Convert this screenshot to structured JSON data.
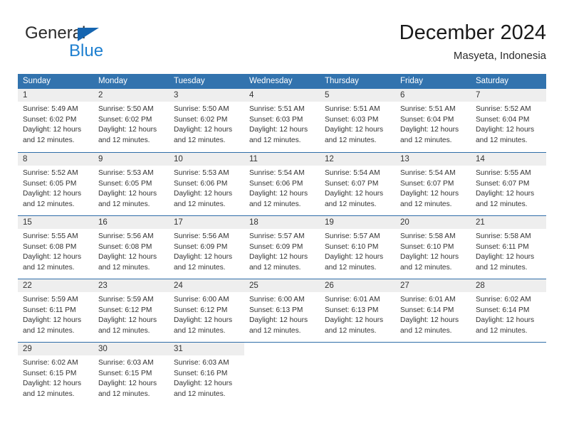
{
  "brand": {
    "word_one": "General",
    "word_two": "Blue",
    "accent_color": "#1d7fd0",
    "triangle_color": "#1565b0"
  },
  "header": {
    "title": "December 2024",
    "subtitle": "Masyeta, Indonesia"
  },
  "calendar": {
    "header_bg": "#3273ae",
    "band_bg": "#eeeeee",
    "weekdays": [
      "Sunday",
      "Monday",
      "Tuesday",
      "Wednesday",
      "Thursday",
      "Friday",
      "Saturday"
    ],
    "weeks": [
      [
        {
          "day": "1",
          "sunrise": "Sunrise: 5:49 AM",
          "sunset": "Sunset: 6:02 PM",
          "daylight_1": "Daylight: 12 hours",
          "daylight_2": "and 12 minutes."
        },
        {
          "day": "2",
          "sunrise": "Sunrise: 5:50 AM",
          "sunset": "Sunset: 6:02 PM",
          "daylight_1": "Daylight: 12 hours",
          "daylight_2": "and 12 minutes."
        },
        {
          "day": "3",
          "sunrise": "Sunrise: 5:50 AM",
          "sunset": "Sunset: 6:02 PM",
          "daylight_1": "Daylight: 12 hours",
          "daylight_2": "and 12 minutes."
        },
        {
          "day": "4",
          "sunrise": "Sunrise: 5:51 AM",
          "sunset": "Sunset: 6:03 PM",
          "daylight_1": "Daylight: 12 hours",
          "daylight_2": "and 12 minutes."
        },
        {
          "day": "5",
          "sunrise": "Sunrise: 5:51 AM",
          "sunset": "Sunset: 6:03 PM",
          "daylight_1": "Daylight: 12 hours",
          "daylight_2": "and 12 minutes."
        },
        {
          "day": "6",
          "sunrise": "Sunrise: 5:51 AM",
          "sunset": "Sunset: 6:04 PM",
          "daylight_1": "Daylight: 12 hours",
          "daylight_2": "and 12 minutes."
        },
        {
          "day": "7",
          "sunrise": "Sunrise: 5:52 AM",
          "sunset": "Sunset: 6:04 PM",
          "daylight_1": "Daylight: 12 hours",
          "daylight_2": "and 12 minutes."
        }
      ],
      [
        {
          "day": "8",
          "sunrise": "Sunrise: 5:52 AM",
          "sunset": "Sunset: 6:05 PM",
          "daylight_1": "Daylight: 12 hours",
          "daylight_2": "and 12 minutes."
        },
        {
          "day": "9",
          "sunrise": "Sunrise: 5:53 AM",
          "sunset": "Sunset: 6:05 PM",
          "daylight_1": "Daylight: 12 hours",
          "daylight_2": "and 12 minutes."
        },
        {
          "day": "10",
          "sunrise": "Sunrise: 5:53 AM",
          "sunset": "Sunset: 6:06 PM",
          "daylight_1": "Daylight: 12 hours",
          "daylight_2": "and 12 minutes."
        },
        {
          "day": "11",
          "sunrise": "Sunrise: 5:54 AM",
          "sunset": "Sunset: 6:06 PM",
          "daylight_1": "Daylight: 12 hours",
          "daylight_2": "and 12 minutes."
        },
        {
          "day": "12",
          "sunrise": "Sunrise: 5:54 AM",
          "sunset": "Sunset: 6:07 PM",
          "daylight_1": "Daylight: 12 hours",
          "daylight_2": "and 12 minutes."
        },
        {
          "day": "13",
          "sunrise": "Sunrise: 5:54 AM",
          "sunset": "Sunset: 6:07 PM",
          "daylight_1": "Daylight: 12 hours",
          "daylight_2": "and 12 minutes."
        },
        {
          "day": "14",
          "sunrise": "Sunrise: 5:55 AM",
          "sunset": "Sunset: 6:07 PM",
          "daylight_1": "Daylight: 12 hours",
          "daylight_2": "and 12 minutes."
        }
      ],
      [
        {
          "day": "15",
          "sunrise": "Sunrise: 5:55 AM",
          "sunset": "Sunset: 6:08 PM",
          "daylight_1": "Daylight: 12 hours",
          "daylight_2": "and 12 minutes."
        },
        {
          "day": "16",
          "sunrise": "Sunrise: 5:56 AM",
          "sunset": "Sunset: 6:08 PM",
          "daylight_1": "Daylight: 12 hours",
          "daylight_2": "and 12 minutes."
        },
        {
          "day": "17",
          "sunrise": "Sunrise: 5:56 AM",
          "sunset": "Sunset: 6:09 PM",
          "daylight_1": "Daylight: 12 hours",
          "daylight_2": "and 12 minutes."
        },
        {
          "day": "18",
          "sunrise": "Sunrise: 5:57 AM",
          "sunset": "Sunset: 6:09 PM",
          "daylight_1": "Daylight: 12 hours",
          "daylight_2": "and 12 minutes."
        },
        {
          "day": "19",
          "sunrise": "Sunrise: 5:57 AM",
          "sunset": "Sunset: 6:10 PM",
          "daylight_1": "Daylight: 12 hours",
          "daylight_2": "and 12 minutes."
        },
        {
          "day": "20",
          "sunrise": "Sunrise: 5:58 AM",
          "sunset": "Sunset: 6:10 PM",
          "daylight_1": "Daylight: 12 hours",
          "daylight_2": "and 12 minutes."
        },
        {
          "day": "21",
          "sunrise": "Sunrise: 5:58 AM",
          "sunset": "Sunset: 6:11 PM",
          "daylight_1": "Daylight: 12 hours",
          "daylight_2": "and 12 minutes."
        }
      ],
      [
        {
          "day": "22",
          "sunrise": "Sunrise: 5:59 AM",
          "sunset": "Sunset: 6:11 PM",
          "daylight_1": "Daylight: 12 hours",
          "daylight_2": "and 12 minutes."
        },
        {
          "day": "23",
          "sunrise": "Sunrise: 5:59 AM",
          "sunset": "Sunset: 6:12 PM",
          "daylight_1": "Daylight: 12 hours",
          "daylight_2": "and 12 minutes."
        },
        {
          "day": "24",
          "sunrise": "Sunrise: 6:00 AM",
          "sunset": "Sunset: 6:12 PM",
          "daylight_1": "Daylight: 12 hours",
          "daylight_2": "and 12 minutes."
        },
        {
          "day": "25",
          "sunrise": "Sunrise: 6:00 AM",
          "sunset": "Sunset: 6:13 PM",
          "daylight_1": "Daylight: 12 hours",
          "daylight_2": "and 12 minutes."
        },
        {
          "day": "26",
          "sunrise": "Sunrise: 6:01 AM",
          "sunset": "Sunset: 6:13 PM",
          "daylight_1": "Daylight: 12 hours",
          "daylight_2": "and 12 minutes."
        },
        {
          "day": "27",
          "sunrise": "Sunrise: 6:01 AM",
          "sunset": "Sunset: 6:14 PM",
          "daylight_1": "Daylight: 12 hours",
          "daylight_2": "and 12 minutes."
        },
        {
          "day": "28",
          "sunrise": "Sunrise: 6:02 AM",
          "sunset": "Sunset: 6:14 PM",
          "daylight_1": "Daylight: 12 hours",
          "daylight_2": "and 12 minutes."
        }
      ],
      [
        {
          "day": "29",
          "sunrise": "Sunrise: 6:02 AM",
          "sunset": "Sunset: 6:15 PM",
          "daylight_1": "Daylight: 12 hours",
          "daylight_2": "and 12 minutes."
        },
        {
          "day": "30",
          "sunrise": "Sunrise: 6:03 AM",
          "sunset": "Sunset: 6:15 PM",
          "daylight_1": "Daylight: 12 hours",
          "daylight_2": "and 12 minutes."
        },
        {
          "day": "31",
          "sunrise": "Sunrise: 6:03 AM",
          "sunset": "Sunset: 6:16 PM",
          "daylight_1": "Daylight: 12 hours",
          "daylight_2": "and 12 minutes."
        },
        {
          "day": "",
          "sunrise": "",
          "sunset": "",
          "daylight_1": "",
          "daylight_2": ""
        },
        {
          "day": "",
          "sunrise": "",
          "sunset": "",
          "daylight_1": "",
          "daylight_2": ""
        },
        {
          "day": "",
          "sunrise": "",
          "sunset": "",
          "daylight_1": "",
          "daylight_2": ""
        },
        {
          "day": "",
          "sunrise": "",
          "sunset": "",
          "daylight_1": "",
          "daylight_2": ""
        }
      ]
    ]
  }
}
